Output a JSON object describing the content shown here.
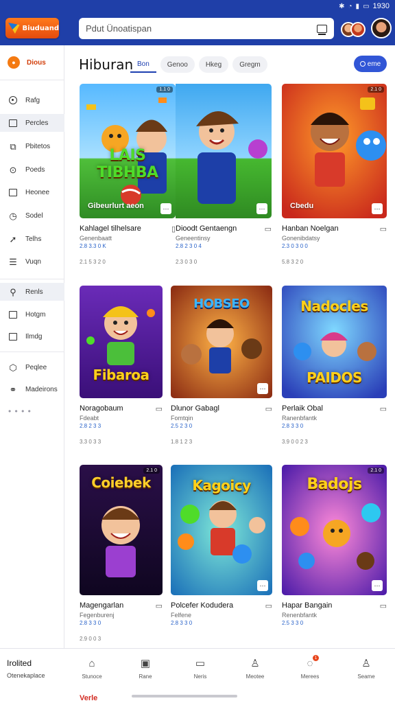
{
  "status_bar": {
    "time": "1930"
  },
  "header": {
    "logo_text": "Biuduand",
    "search_placeholder": "Pdut Ünoatispan"
  },
  "sidebar": {
    "items": [
      {
        "label": "Dious",
        "icon": "flame-icon"
      },
      {
        "label": "Rafg",
        "icon": "target-icon"
      },
      {
        "label": "Percles",
        "icon": "square-icon"
      },
      {
        "label": "Pbitetos",
        "icon": "photo-icon"
      },
      {
        "label": "Poeds",
        "icon": "location-icon"
      },
      {
        "label": "Heonee",
        "icon": "bookmark-icon"
      },
      {
        "label": "Sodel",
        "icon": "timer-icon"
      },
      {
        "label": "Telhs",
        "icon": "send-icon"
      },
      {
        "label": "Vuqn",
        "icon": "list-icon"
      },
      {
        "label": "Renls",
        "icon": "search-icon"
      },
      {
        "label": "Hotgm",
        "icon": "calendar-icon"
      },
      {
        "label": "Ilmdg",
        "icon": "info-icon"
      },
      {
        "label": "Peqlee",
        "icon": "cube-icon"
      },
      {
        "label": "Madeirons",
        "icon": "link-icon"
      }
    ],
    "more": "• • • •"
  },
  "main": {
    "title": "Hiburan",
    "tabs": [
      "Bon",
      "Genoo",
      "Hkeg",
      "Gregm"
    ],
    "action_label": "eme"
  },
  "cards": [
    {
      "title": "Kahlagel tilhelsare",
      "sub": "Genenbaatt",
      "stat": "2.8 3.3 0 K",
      "meta": "2.1 5 3 2 0",
      "hero": "LAIS TIBHBA",
      "caption": "Gibeurlurt aeon",
      "badge": "1.1 0",
      "theme": "green"
    },
    {
      "title": "Dioodt Gentaengn",
      "sub": "Geneentinsy",
      "stat": "2.8 2 3 0 4",
      "meta": "2.3 0 3 0",
      "hero": "",
      "caption": "",
      "badge": "",
      "theme": "green"
    },
    {
      "title": "Hanban Noelgan",
      "sub": "Gonenibdatsy",
      "stat": "2.3 0 3 0 0",
      "meta": "5.8 3 2 0",
      "hero": "",
      "caption": "Cbedu",
      "badge": "2.1 0",
      "theme": "red"
    },
    {
      "title": "Noragobaum",
      "sub": "Fdeabt",
      "stat": "2.8 2 3 3",
      "meta": "3.3 0 3 3",
      "hero": "Fibaroa",
      "caption": "",
      "badge": "",
      "theme": "purple"
    },
    {
      "title": "Dlunor Gabagl",
      "sub": "Fomtqin",
      "stat": "2.5 2 3 0",
      "meta": "1.8 1 2 3",
      "hero": "HOBSEO",
      "caption": "",
      "badge": "",
      "theme": "orange"
    },
    {
      "title": "Perlaik Obal",
      "sub": "Ranenbfantk",
      "stat": "2.8 3 3 0",
      "meta": "3.9 0 0 2 3",
      "hero": "Nadocles",
      "caption": "",
      "badge": "",
      "theme": "blue"
    },
    {
      "title": "Magengarlan",
      "sub": "Fegenburenj",
      "stat": "2.8 3 3 0",
      "meta": "2.9 0 0 3",
      "hero": "Coiebek",
      "caption": "",
      "badge": "2.1 0",
      "theme": "dark"
    },
    {
      "title": "Polcefer Kodudera",
      "sub": "Felfene",
      "stat": "2.8 3 3 0",
      "meta": "",
      "hero": "Kagoicy",
      "caption": "",
      "badge": "",
      "theme": "teal"
    },
    {
      "title": "Hapar Bangain",
      "sub": "Renenbfantk",
      "stat": "2.5 3 3 0",
      "meta": "",
      "hero": "Badojs",
      "caption": "",
      "badge": "2.1 0",
      "theme": "violet"
    }
  ],
  "bottom_nav": {
    "brand": "Irolited",
    "brand_sub": "Otenekaplace",
    "brand_foot": "Verle",
    "items": [
      {
        "label": "Stunoce",
        "icon": "home-icon"
      },
      {
        "label": "Rane",
        "icon": "image-icon"
      },
      {
        "label": "Neris",
        "icon": "message-icon"
      },
      {
        "label": "Meotee",
        "icon": "person-icon"
      },
      {
        "label": "Merees",
        "icon": "bell-icon"
      },
      {
        "label": "Seame",
        "icon": "profile-icon"
      }
    ],
    "notification_count": "1"
  },
  "colors": {
    "primary": "#1f3fa8",
    "accent": "#3156d6",
    "brand_orange": "#f47a12",
    "link_blue": "#2a63c9"
  }
}
